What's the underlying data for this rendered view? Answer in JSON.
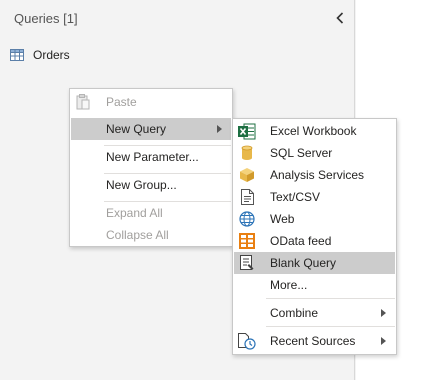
{
  "queries_pane": {
    "title": "Queries [1]",
    "collapse_icon": "chevron-left-icon",
    "items": [
      {
        "label": "Orders",
        "icon": "table-icon"
      }
    ]
  },
  "context_menu": {
    "items": [
      {
        "label": "Paste",
        "icon": "paste-icon",
        "enabled": false
      },
      {
        "label": "New Query",
        "enabled": true,
        "submenu": true,
        "highlighted": true
      },
      {
        "label": "New Parameter...",
        "enabled": true
      },
      {
        "label": "New Group...",
        "enabled": true
      },
      {
        "label": "Expand All",
        "enabled": false
      },
      {
        "label": "Collapse All",
        "enabled": false
      }
    ]
  },
  "new_query_submenu": {
    "items": [
      {
        "label": "Excel Workbook",
        "icon": "excel-icon"
      },
      {
        "label": "SQL Server",
        "icon": "database-icon"
      },
      {
        "label": "Analysis Services",
        "icon": "cube-icon"
      },
      {
        "label": "Text/CSV",
        "icon": "text-file-icon"
      },
      {
        "label": "Web",
        "icon": "globe-icon"
      },
      {
        "label": "OData feed",
        "icon": "odata-icon"
      },
      {
        "label": "Blank Query",
        "icon": "blank-query-icon",
        "highlighted": true
      },
      {
        "label": "More..."
      },
      {
        "label": "Combine",
        "submenu": true
      },
      {
        "label": "Recent Sources",
        "icon": "recent-sources-icon",
        "submenu": true
      }
    ]
  },
  "colors": {
    "pane_background": "#f3f3f3",
    "highlight": "#cccccc",
    "disabled_text": "#a19f9d",
    "excel_green": "#1d6f42",
    "sql_yellow": "#e8b84a",
    "odata_orange": "#e97f10",
    "web_blue": "#2b73b7"
  }
}
